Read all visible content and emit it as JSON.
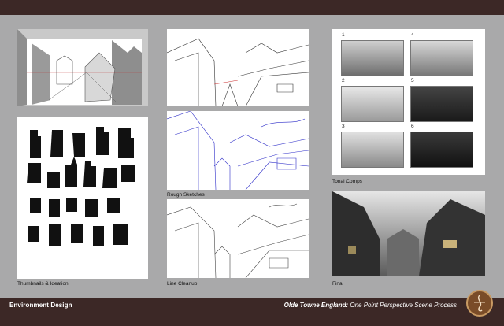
{
  "footer": {
    "left_title": "Environment Design",
    "right_title_italic": "Olde Towne England:",
    "right_title_rest": " One Point Perspective Scene Process"
  },
  "captions": {
    "thumbnails": "Thumbnails & Ideation",
    "rough": "Rough Sketches",
    "cleanup": "Line Cleanup",
    "tonal": "Tonal Comps",
    "final": "Final"
  },
  "tonal_numbers": [
    "1",
    "2",
    "3",
    "4",
    "5",
    "6"
  ],
  "colors": {
    "background": "#a9a9aa",
    "bar": "#3c2826",
    "sketch_blue": "#2c2cc8",
    "logo": "#7a4c28"
  }
}
